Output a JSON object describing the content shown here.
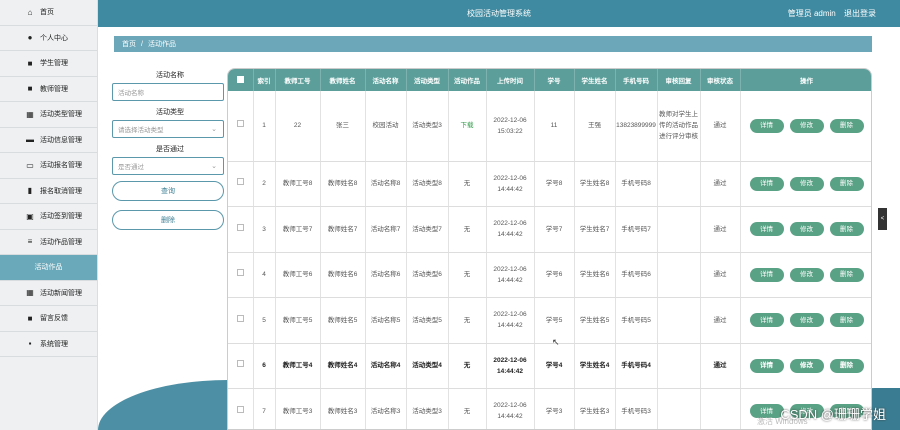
{
  "sidebar": {
    "items": [
      {
        "label": "首页",
        "icon": "home-icon",
        "glyph": "⌂"
      },
      {
        "label": "个人中心",
        "icon": "user-icon",
        "glyph": "●"
      },
      {
        "label": "学生管理",
        "icon": "grid-icon",
        "glyph": "■"
      },
      {
        "label": "教师管理",
        "icon": "grid-icon",
        "glyph": "■"
      },
      {
        "label": "活动类型管理",
        "icon": "apps-icon",
        "glyph": "▦"
      },
      {
        "label": "活动信息管理",
        "icon": "monitor-icon",
        "glyph": "▬"
      },
      {
        "label": "活动报名管理",
        "icon": "inbox-icon",
        "glyph": "▭"
      },
      {
        "label": "报名取消管理",
        "icon": "bar-chart-icon",
        "glyph": "▮"
      },
      {
        "label": "活动签到管理",
        "icon": "calendar-icon",
        "glyph": "▣"
      },
      {
        "label": "活动作品管理",
        "icon": "sliders-icon",
        "glyph": "≡"
      },
      {
        "label": "活动作品",
        "icon": "",
        "glyph": "",
        "active": true
      },
      {
        "label": "活动新闻管理",
        "icon": "grid-icon",
        "glyph": "▦"
      },
      {
        "label": "留言反馈",
        "icon": "grid-icon",
        "glyph": "■"
      },
      {
        "label": "系统管理",
        "icon": "settings-icon",
        "glyph": "▪"
      }
    ]
  },
  "header": {
    "title": "校园活动管理系统",
    "user": "管理员 admin",
    "logout": "退出登录"
  },
  "breadcrumb": {
    "home": "首页",
    "sep": "/",
    "current": "活动作品"
  },
  "search": {
    "name_label": "活动名称",
    "name_placeholder": "活动名称",
    "type_label": "活动类型",
    "type_placeholder": "请选择活动类型",
    "pass_label": "是否通过",
    "pass_placeholder": "是否通过",
    "query_btn": "查询",
    "delete_btn": "删除"
  },
  "table": {
    "headers": [
      "索引",
      "教师工号",
      "教师姓名",
      "活动名称",
      "活动类型",
      "活动作品",
      "上传时间",
      "学号",
      "学生姓名",
      "手机号码",
      "审核回复",
      "审核状态",
      "操作"
    ],
    "rows": [
      [
        "1",
        "22",
        "张三",
        "校园活动",
        "活动类型3",
        "下载",
        "2022-12-06 15:03:22",
        "11",
        "王强",
        "13823899999",
        "教师对学生上传的活动作品进行评分审核",
        "通过"
      ],
      [
        "2",
        "教师工号8",
        "教师姓名8",
        "活动名称8",
        "活动类型8",
        "无",
        "2022-12-06 14:44:42",
        "学号8",
        "学生姓名8",
        "手机号码8",
        "",
        "通过"
      ],
      [
        "3",
        "教师工号7",
        "教师姓名7",
        "活动名称7",
        "活动类型7",
        "无",
        "2022-12-06 14:44:42",
        "学号7",
        "学生姓名7",
        "手机号码7",
        "",
        "通过"
      ],
      [
        "4",
        "教师工号6",
        "教师姓名6",
        "活动名称6",
        "活动类型6",
        "无",
        "2022-12-06 14:44:42",
        "学号6",
        "学生姓名6",
        "手机号码6",
        "",
        "通过"
      ],
      [
        "5",
        "教师工号5",
        "教师姓名5",
        "活动名称5",
        "活动类型5",
        "无",
        "2022-12-06 14:44:42",
        "学号5",
        "学生姓名5",
        "手机号码5",
        "",
        "通过"
      ],
      [
        "6",
        "教师工号4",
        "教师姓名4",
        "活动名称4",
        "活动类型4",
        "无",
        "2022-12-06 14:44:42",
        "学号4",
        "学生姓名4",
        "手机号码4",
        "",
        "通过"
      ],
      [
        "7",
        "教师工号3",
        "教师姓名3",
        "活动名称3",
        "活动类型3",
        "无",
        "2022-12-06 14:44:42",
        "学号3",
        "学生姓名3",
        "手机号码3",
        "",
        ""
      ]
    ],
    "ops": [
      "详情",
      "修改",
      "删除"
    ]
  },
  "watermark": "CSDN @珊珊学姐",
  "windows_mark": "激活 Windows",
  "colors": {
    "topbar": "#3f8aa0",
    "header_row": "#5b9e9a",
    "op_button": "#5aa286",
    "active_sidebar": "#6aa9ba"
  }
}
